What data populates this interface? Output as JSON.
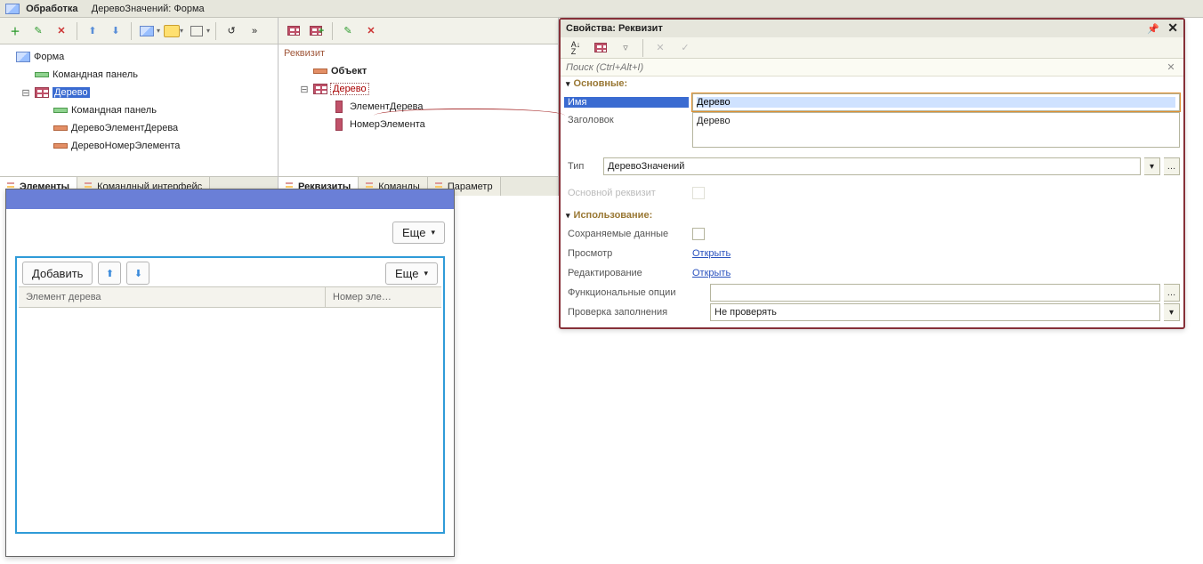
{
  "title": {
    "prefix": "Обработка",
    "rest": "ДеревоЗначений: Форма"
  },
  "leftTree": {
    "form": "Форма",
    "cmdpanel": "Командная панель",
    "derevo": "Дерево",
    "derevo_cmdpanel": "Командная панель",
    "elem": "ДеревоЭлементДерева",
    "num": "ДеревоНомерЭлемента"
  },
  "leftTabs": {
    "elements": "Элементы",
    "cmdui": "Командный интерфейс"
  },
  "midCaption": "Реквизит",
  "midTree": {
    "object": "Объект",
    "derevo": "Дерево",
    "elem": "ЭлементДерева",
    "num": "НомерЭлемента"
  },
  "midTabs": {
    "req": "Реквизиты",
    "cmd": "Команды",
    "par": "Параметр"
  },
  "preview": {
    "more": "Еще",
    "add": "Добавить",
    "col1": "Элемент дерева",
    "col2": "Номер эле…"
  },
  "props": {
    "title": "Свойства: Реквизит",
    "search_ph": "Поиск (Ctrl+Alt+I)",
    "s_main": "Основные:",
    "s_use": "Использование:",
    "name_l": "Имя",
    "name_v": "Дерево",
    "titl_l": "Заголовок",
    "titl_v": "Дерево",
    "type_l": "Тип",
    "type_v": "ДеревоЗначений",
    "mainreq_l": "Основной реквизит",
    "savedata_l": "Сохраняемые данные",
    "view_l": "Просмотр",
    "view_v": "Открыть",
    "edit_l": "Редактирование",
    "edit_v": "Открыть",
    "funcopt_l": "Функциональные опции",
    "fillchk_l": "Проверка заполнения",
    "fillchk_v": "Не проверять"
  }
}
